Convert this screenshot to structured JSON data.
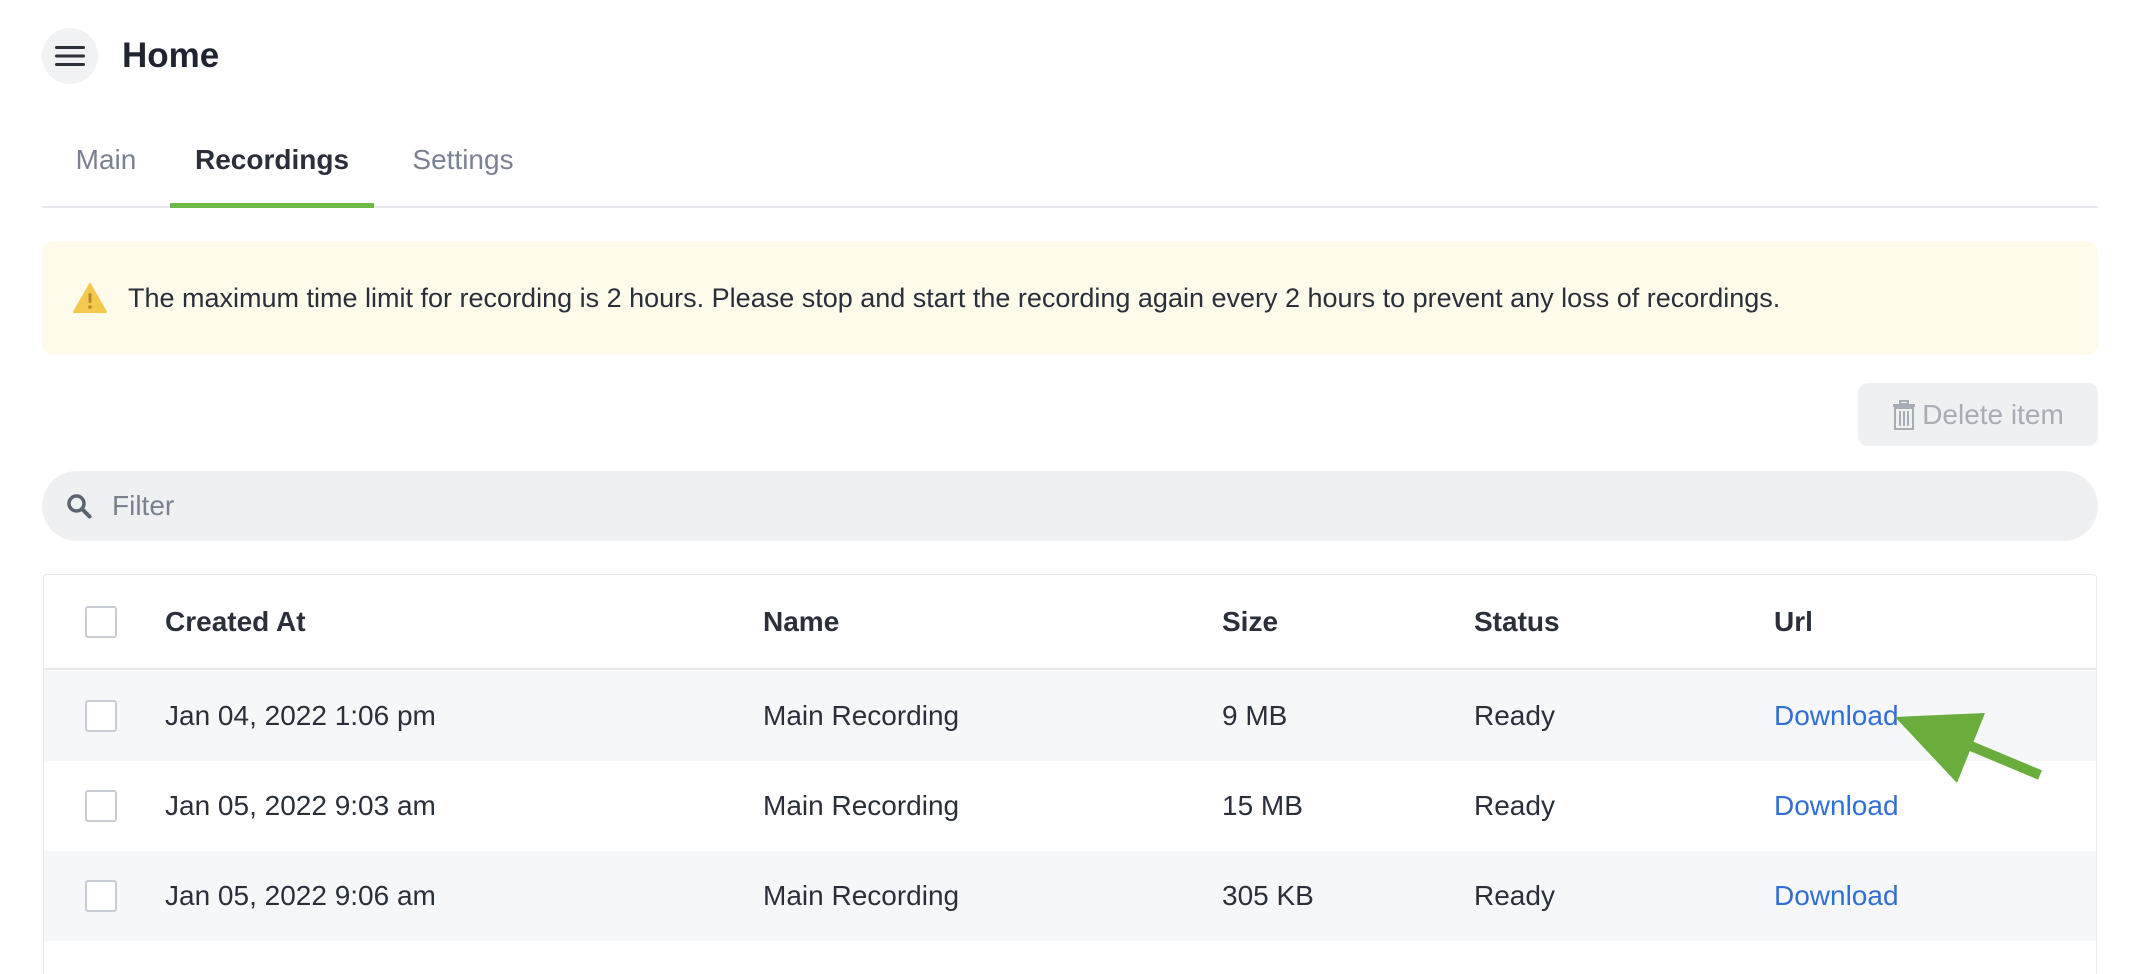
{
  "header": {
    "title": "Home",
    "menu_icon": "hamburger-menu-icon"
  },
  "tabs": [
    {
      "label": "Main",
      "active": false
    },
    {
      "label": "Recordings",
      "active": true
    },
    {
      "label": "Settings",
      "active": false
    }
  ],
  "alert": {
    "icon": "warning-icon",
    "text": "The maximum time limit for recording is 2 hours. Please stop and start the recording again every 2 hours to prevent any loss of recordings."
  },
  "toolbar": {
    "delete_label": "Delete item",
    "delete_icon": "trash-icon"
  },
  "filter": {
    "placeholder": "Filter",
    "value": "",
    "icon": "search-icon"
  },
  "table": {
    "headers": [
      "Created At",
      "Name",
      "Size",
      "Status",
      "Url"
    ],
    "rows": [
      {
        "created_at": "Jan 04, 2022 1:06 pm",
        "name": "Main Recording",
        "size": "9 MB",
        "status": "Ready",
        "url": "Download"
      },
      {
        "created_at": "Jan 05, 2022 9:03 am",
        "name": "Main Recording",
        "size": "15 MB",
        "status": "Ready",
        "url": "Download"
      },
      {
        "created_at": "Jan 05, 2022 9:06 am",
        "name": "Main Recording",
        "size": "305 KB",
        "status": "Ready",
        "url": "Download"
      }
    ]
  },
  "colors": {
    "accent": "#6cb94a",
    "link": "#2f6fd6",
    "alert_bg": "#fefbeb",
    "warning": "#f2c94c",
    "arrow": "#6aad3c"
  }
}
